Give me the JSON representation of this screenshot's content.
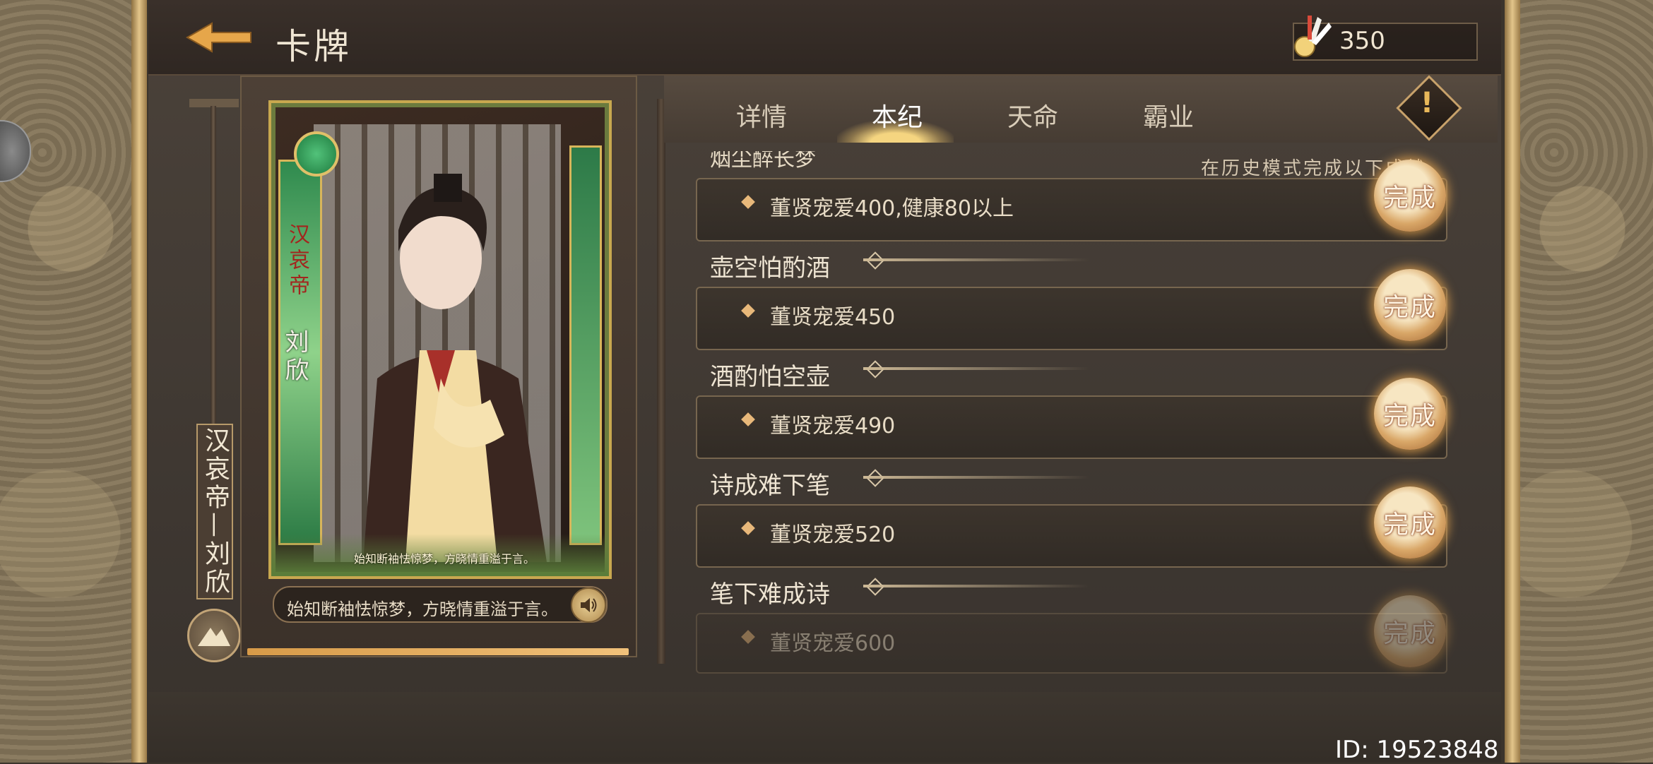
{
  "header": {
    "title": "卡牌",
    "currency_value": "350",
    "back_icon": "back-arrow-icon",
    "currency_icon": "feather-token-icon"
  },
  "tabs": [
    {
      "label": "详情",
      "active": false
    },
    {
      "label": "本纪",
      "active": true
    },
    {
      "label": "天命",
      "active": false
    },
    {
      "label": "霸业",
      "active": false
    }
  ],
  "card": {
    "seal_text": "",
    "vertical_title": "汉哀帝",
    "vertical_name": "刘欣",
    "quote": "始知断袖怯惊梦，方晓情重溢于言。",
    "name_plate": "汉哀帝—刘欣"
  },
  "quote_bar": {
    "text": "始知断袖怯惊梦，方晓情重溢于言。"
  },
  "list": {
    "partial_header": "烟尘醉长梦",
    "partial_note": "在历史模式完成以下成就",
    "sections": [
      {
        "title": "",
        "task": "董贤宠爱400,健康80以上",
        "status": "完成",
        "faded": false
      },
      {
        "title": "壶空怕酌酒",
        "task": "董贤宠爱450",
        "status": "完成",
        "faded": false
      },
      {
        "title": "酒酌怕空壶",
        "task": "董贤宠爱490",
        "status": "完成",
        "faded": false
      },
      {
        "title": "诗成难下笔",
        "task": "董贤宠爱520",
        "status": "完成",
        "faded": false
      },
      {
        "title": "笔下难成诗",
        "task": "董贤宠爱600",
        "status": "完成",
        "faded": true
      }
    ]
  },
  "footer": {
    "id_text": "ID: 19523848"
  },
  "colors": {
    "accent_gold": "#e8b85a",
    "done_glow": "#eeaa50"
  }
}
